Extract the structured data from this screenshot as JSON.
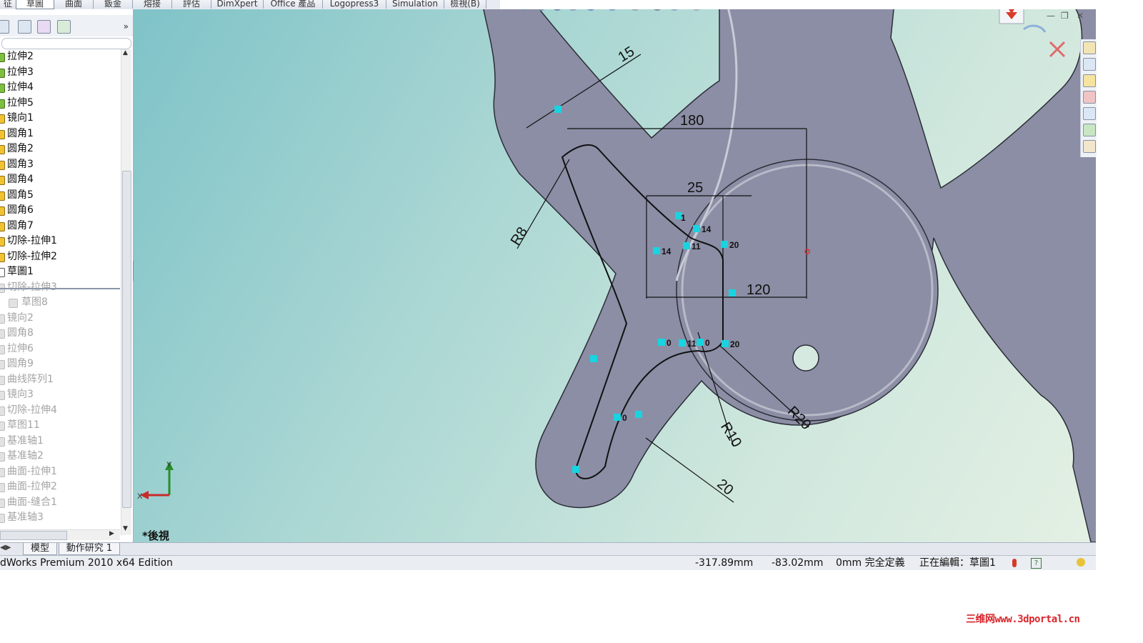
{
  "tabs": [
    {
      "label": "征"
    },
    {
      "label": "草圖"
    },
    {
      "label": "曲面"
    },
    {
      "label": "鈑金"
    },
    {
      "label": "熔接"
    },
    {
      "label": "評估"
    },
    {
      "label": "DimXpert"
    },
    {
      "label": "Office 產品"
    },
    {
      "label": "Logopress3"
    },
    {
      "label": "Simulation"
    },
    {
      "label": "檢視(B)"
    }
  ],
  "feature_tree": {
    "more_glyph": "»",
    "items": [
      {
        "label": "拉伸2",
        "suppressed": false
      },
      {
        "label": "拉伸3",
        "suppressed": false
      },
      {
        "label": "拉伸4",
        "suppressed": false
      },
      {
        "label": "拉伸5",
        "suppressed": false
      },
      {
        "label": "镜向1",
        "suppressed": false
      },
      {
        "label": "圆角1",
        "suppressed": false
      },
      {
        "label": "圆角2",
        "suppressed": false
      },
      {
        "label": "圆角3",
        "suppressed": false
      },
      {
        "label": "圆角4",
        "suppressed": false
      },
      {
        "label": "圆角5",
        "suppressed": false
      },
      {
        "label": "圆角6",
        "suppressed": false
      },
      {
        "label": "圆角7",
        "suppressed": false
      },
      {
        "label": "切除-拉伸1",
        "suppressed": false
      },
      {
        "label": "切除-拉伸2",
        "suppressed": false
      },
      {
        "label": "草圖1",
        "suppressed": false
      },
      {
        "label": "切除-拉伸3",
        "suppressed": true
      },
      {
        "label": "草图8",
        "suppressed": true,
        "sub": true
      },
      {
        "label": "镜向2",
        "suppressed": true
      },
      {
        "label": "圆角8",
        "suppressed": true
      },
      {
        "label": "拉伸6",
        "suppressed": true
      },
      {
        "label": "圆角9",
        "suppressed": true
      },
      {
        "label": "曲线阵列1",
        "suppressed": true
      },
      {
        "label": "镜向3",
        "suppressed": true
      },
      {
        "label": "切除-拉伸4",
        "suppressed": true
      },
      {
        "label": "草图11",
        "suppressed": true
      },
      {
        "label": "基准轴1",
        "suppressed": true
      },
      {
        "label": "基准轴2",
        "suppressed": true
      },
      {
        "label": "曲面-拉伸1",
        "suppressed": true
      },
      {
        "label": "曲面-拉伸2",
        "suppressed": true
      },
      {
        "label": "曲面-缝合1",
        "suppressed": true
      },
      {
        "label": "基准轴3",
        "suppressed": true
      }
    ]
  },
  "graphics": {
    "view_name": "*後視",
    "triad": {
      "x_label": "X",
      "y_label": "Y"
    },
    "dimensions": [
      "15",
      "180",
      "25",
      "120",
      "R8",
      "R10",
      "R20",
      "20"
    ],
    "relations": [
      "14",
      "14",
      "11",
      "20",
      "11",
      "20",
      "0",
      "0",
      "0",
      "1"
    ]
  },
  "bottom_tabs": [
    {
      "label": "模型"
    },
    {
      "label": "動作研究 1"
    }
  ],
  "status_bar": {
    "app_name": "dWorks Premium 2010 x64 Edition",
    "x_coord": "-317.89mm",
    "y_coord": "-83.02mm",
    "z_state": "0mm 完全定義",
    "editing": "正在編輯：草圖1"
  },
  "watermark": "三维网www.3dportal.cn",
  "colors": {
    "part_fill": "#8b8ea5",
    "sketch_line": "#111111",
    "relation_icon": "#19d3e0",
    "dimension_text": "#111111",
    "watermark": "#d8262c"
  }
}
